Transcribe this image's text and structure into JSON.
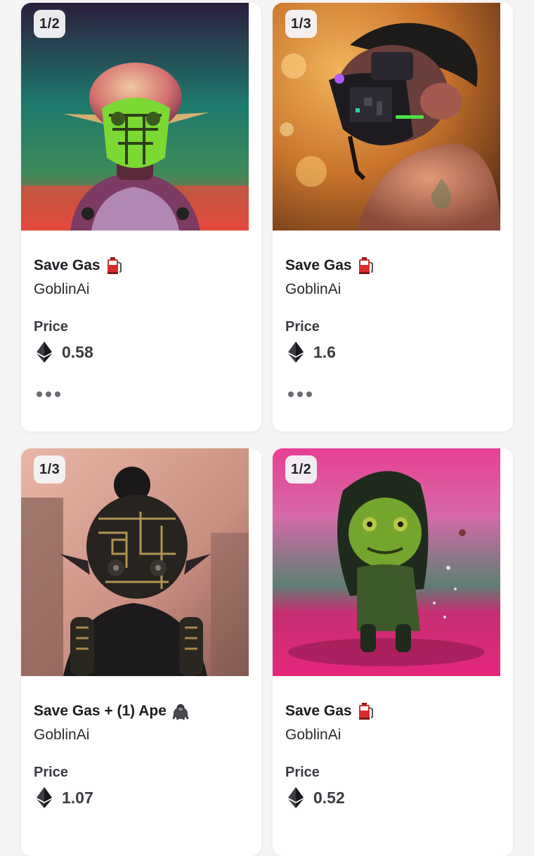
{
  "cards": [
    {
      "badge": "1/2",
      "title": "Save Gas",
      "title_emoji": "fuel-pump-icon",
      "creator": "GoblinAi",
      "price_label": "Price",
      "price": "0.58",
      "currency_icon": "ethereum-icon",
      "more_icon": "more-options-icon"
    },
    {
      "badge": "1/3",
      "title": "Save Gas",
      "title_emoji": "fuel-pump-icon",
      "creator": "GoblinAi",
      "price_label": "Price",
      "price": "1.6",
      "currency_icon": "ethereum-icon",
      "more_icon": "more-options-icon"
    },
    {
      "badge": "1/3",
      "title": "Save Gas + (1) Ape",
      "title_emoji": "gorilla-icon",
      "creator": "GoblinAi",
      "price_label": "Price",
      "price": "1.07",
      "currency_icon": "ethereum-icon"
    },
    {
      "badge": "1/2",
      "title": "Save Gas",
      "title_emoji": "fuel-pump-icon",
      "creator": "GoblinAi",
      "price_label": "Price",
      "price": "0.52",
      "currency_icon": "ethereum-icon"
    }
  ]
}
